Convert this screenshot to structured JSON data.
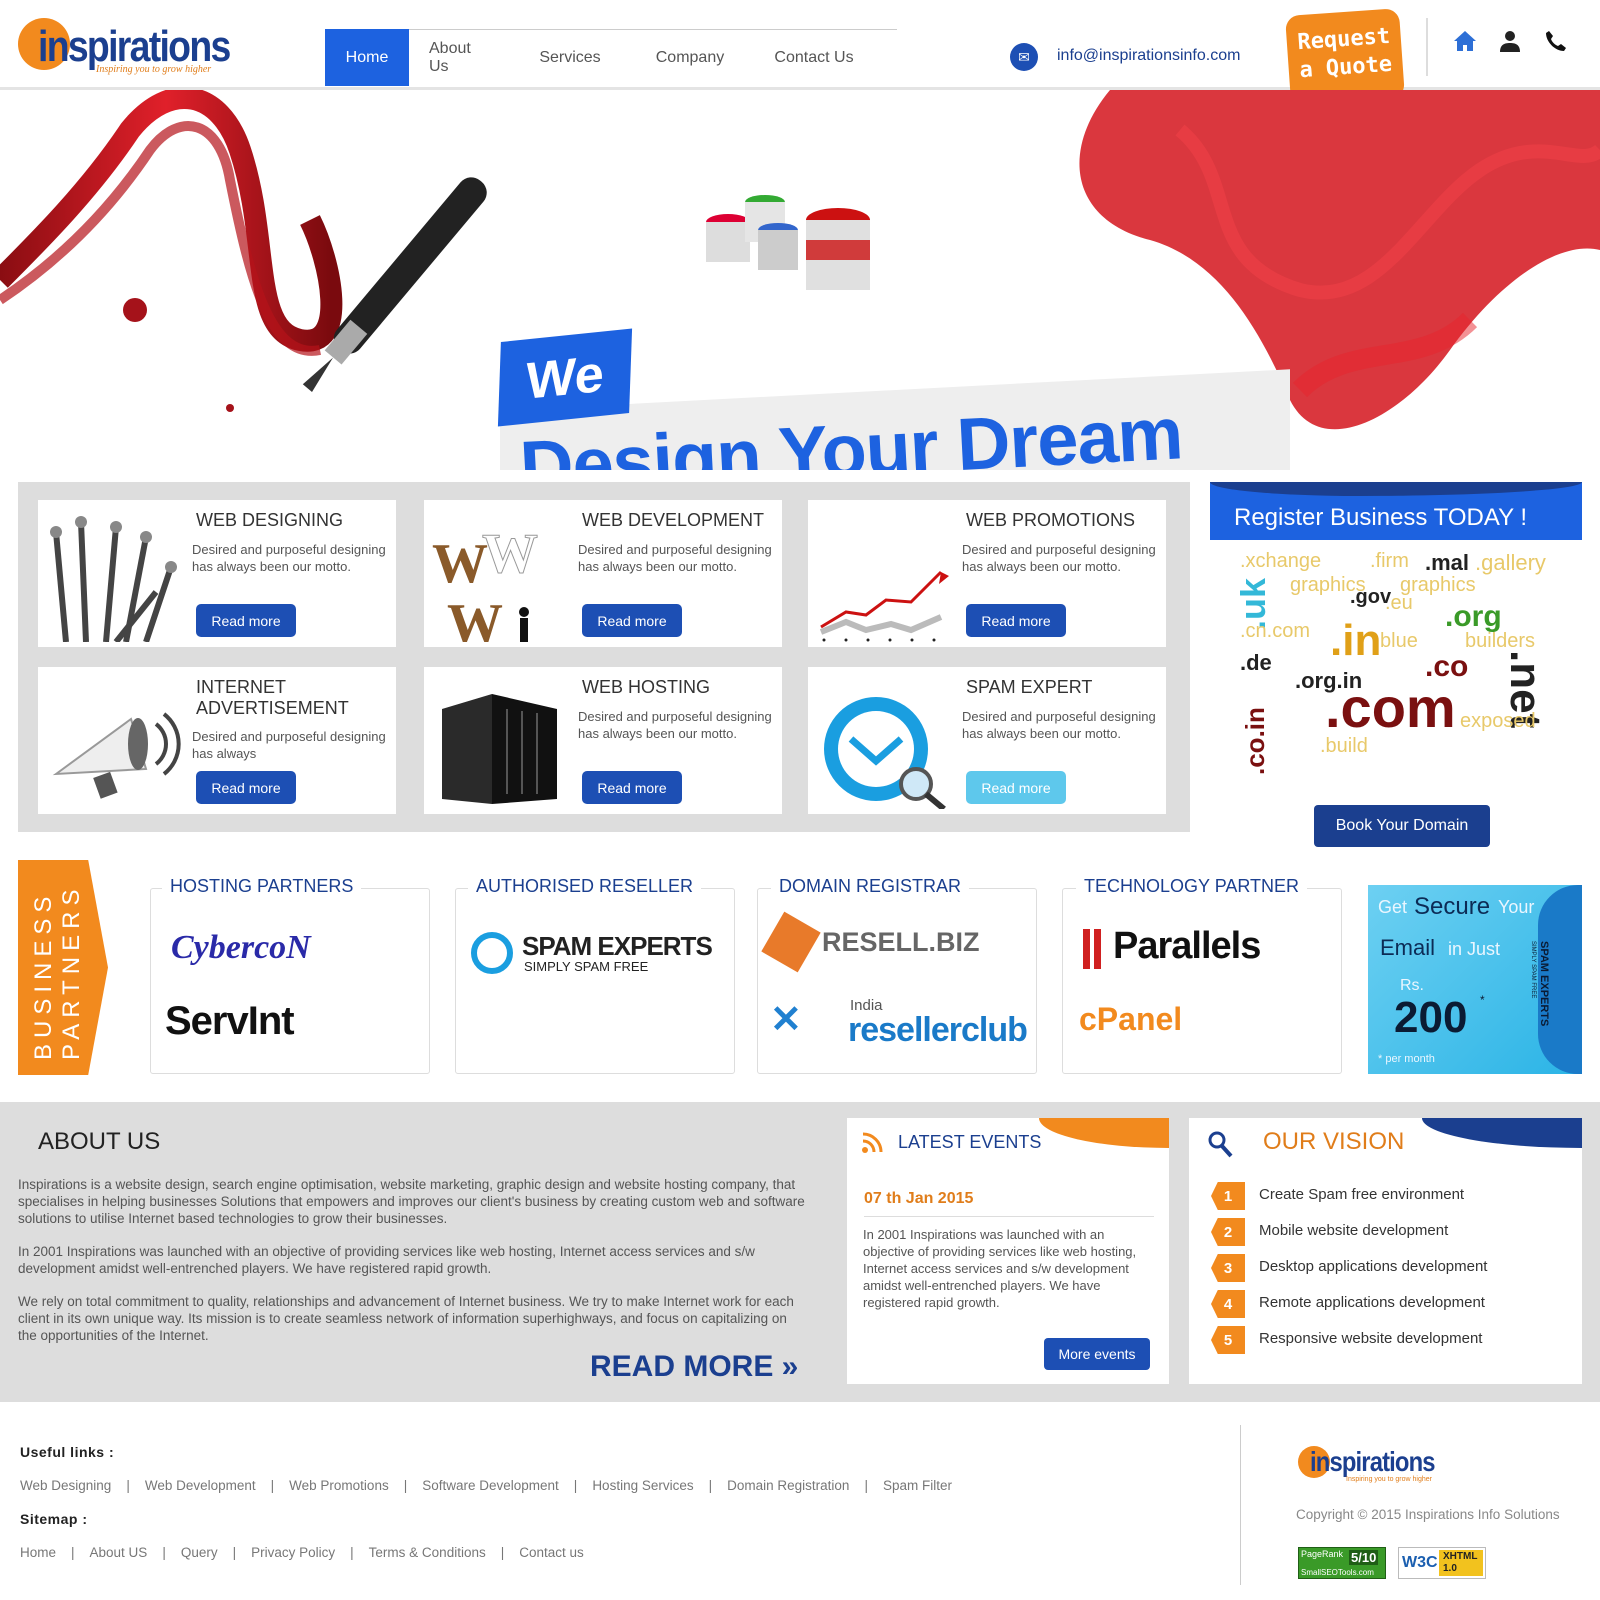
{
  "brand": {
    "logo_text": "inspirations",
    "tagline": "Inspiring you to grow higher"
  },
  "nav": {
    "items": [
      {
        "label": "Home",
        "active": true
      },
      {
        "label": "About Us"
      },
      {
        "label": "Services"
      },
      {
        "label": "Company"
      },
      {
        "label": "Contact Us"
      }
    ]
  },
  "header": {
    "email": "info@inspirationsinfo.com",
    "quote_line1": "Request",
    "quote_line2": "a Quote",
    "icons": [
      "home-icon",
      "user-icon",
      "phone-icon"
    ]
  },
  "hero": {
    "we": "We",
    "headline": "Design Your Dream"
  },
  "services": [
    {
      "title": "WEB DESIGNING",
      "desc": "Desired and purposeful designing has always been our motto.",
      "button": "Read more"
    },
    {
      "title": "WEB DEVELOPMENT",
      "desc": "Desired and purposeful designing has always been our motto.",
      "button": "Read more"
    },
    {
      "title": "WEB PROMOTIONS",
      "desc": "Desired and purposeful designing has always been our motto.",
      "button": "Read more"
    },
    {
      "title": "INTERNET ADVERTISEMENT",
      "desc": "Desired and purposeful designing has always",
      "button": "Read more"
    },
    {
      "title": "WEB HOSTING",
      "desc": "Desired and purposeful designing has always been our motto.",
      "button": "Read more"
    },
    {
      "title": "SPAM EXPERT",
      "desc": "Desired and purposeful designing has always been our motto.",
      "button": "Read more"
    }
  ],
  "register": {
    "title": "Register Business TODAY !",
    "button": "Book Your Domain",
    "words": [
      ".xchange",
      ".firm",
      ".mal",
      ".gallery",
      ".uk",
      "graphics",
      ".gov",
      "graphics",
      ".org",
      ".in",
      ".de",
      ".co",
      ".net",
      ".org.in",
      ".com",
      ".co.in",
      ".cn.com",
      ".eu",
      "blue",
      "builders",
      ".build",
      "exposed"
    ]
  },
  "partners": {
    "tab": "BUSINESS PARTNERS",
    "groups": [
      {
        "title": "HOSTING PARTNERS",
        "logos": [
          "CybercoN",
          "ServInt"
        ]
      },
      {
        "title": "AUTHORISED RESELLER",
        "logos": [
          "SPAM EXPERTS",
          "SIMPLY SPAM FREE"
        ]
      },
      {
        "title": "DOMAIN REGISTRAR",
        "logos": [
          "RESELL.BIZ",
          "India",
          "resellerclub"
        ]
      },
      {
        "title": "TECHNOLOGY PARTNER",
        "logos": [
          "Parallels",
          "cPanel"
        ]
      }
    ],
    "ad": {
      "get": "Get",
      "secure": "Secure",
      "your": "Your",
      "email": "Email",
      "injust": "in Just",
      "rs": "Rs.",
      "price": "200",
      "star": "*",
      "per": "* per month",
      "side": "SPAM EXPERTS",
      "side_sub": "SIMPLY SPAM FREE"
    }
  },
  "about": {
    "title": "ABOUT US",
    "p1": "Inspirations is a website design, search engine optimisation, website marketing, graphic design and website hosting company, that specialises in helping businesses Solutions that empowers and improves our client's business by creating custom web and software solutions to utilise Internet based technologies to grow their businesses.",
    "p2": "In 2001 Inspirations was launched with an objective of providing services like web hosting, Internet access services and s/w development amidst well-entrenched players. We have registered rapid growth.",
    "p3": "We rely on total commitment to quality, relationships and advancement of Internet business. We try to make Internet work for each client in its own unique way. Its mission is to create seamless network of information superhighways, and focus on capitalizing on the opportunities of the Internet.",
    "read_more": "READ MORE »"
  },
  "events": {
    "title": "LATEST EVENTS",
    "date": "07 th Jan 2015",
    "text": "In 2001 Inspirations was launched with an objective of providing services like web hosting, Internet access services and s/w development amidst well-entrenched players. We have registered rapid growth.",
    "button": "More events"
  },
  "vision": {
    "title": "OUR VISION",
    "items": [
      {
        "num": "1",
        "text": "Create Spam free environment"
      },
      {
        "num": "2",
        "text": "Mobile website development"
      },
      {
        "num": "3",
        "text": "Desktop applications development"
      },
      {
        "num": "4",
        "text": "Remote applications development"
      },
      {
        "num": "5",
        "text": "Responsive website development"
      }
    ]
  },
  "footer": {
    "useful_label": "Useful links :",
    "useful": [
      "Web Designing",
      "Web Development",
      "Web Promotions",
      "Software Development",
      "Hosting Services",
      "Domain Registration",
      "Spam Filter"
    ],
    "sitemap_label": "Sitemap :",
    "sitemap": [
      "Home",
      "About US",
      "Query",
      "Privacy Policy",
      "Terms & Conditions",
      "Contact us"
    ],
    "copyright": "Copyright © 2015 Inspirations Info Solutions",
    "badge1_top": "PageRank",
    "badge1_val": "5/10",
    "badge1_sub": "SmallSEOTools.com",
    "badge2": "W3C",
    "badge2_b": "XHTML",
    "badge2_c": "1.0"
  },
  "colors": {
    "blue": "#1d62e0",
    "navy": "#1b3f8f",
    "orange": "#f28a1e",
    "gray": "#dddddd"
  }
}
